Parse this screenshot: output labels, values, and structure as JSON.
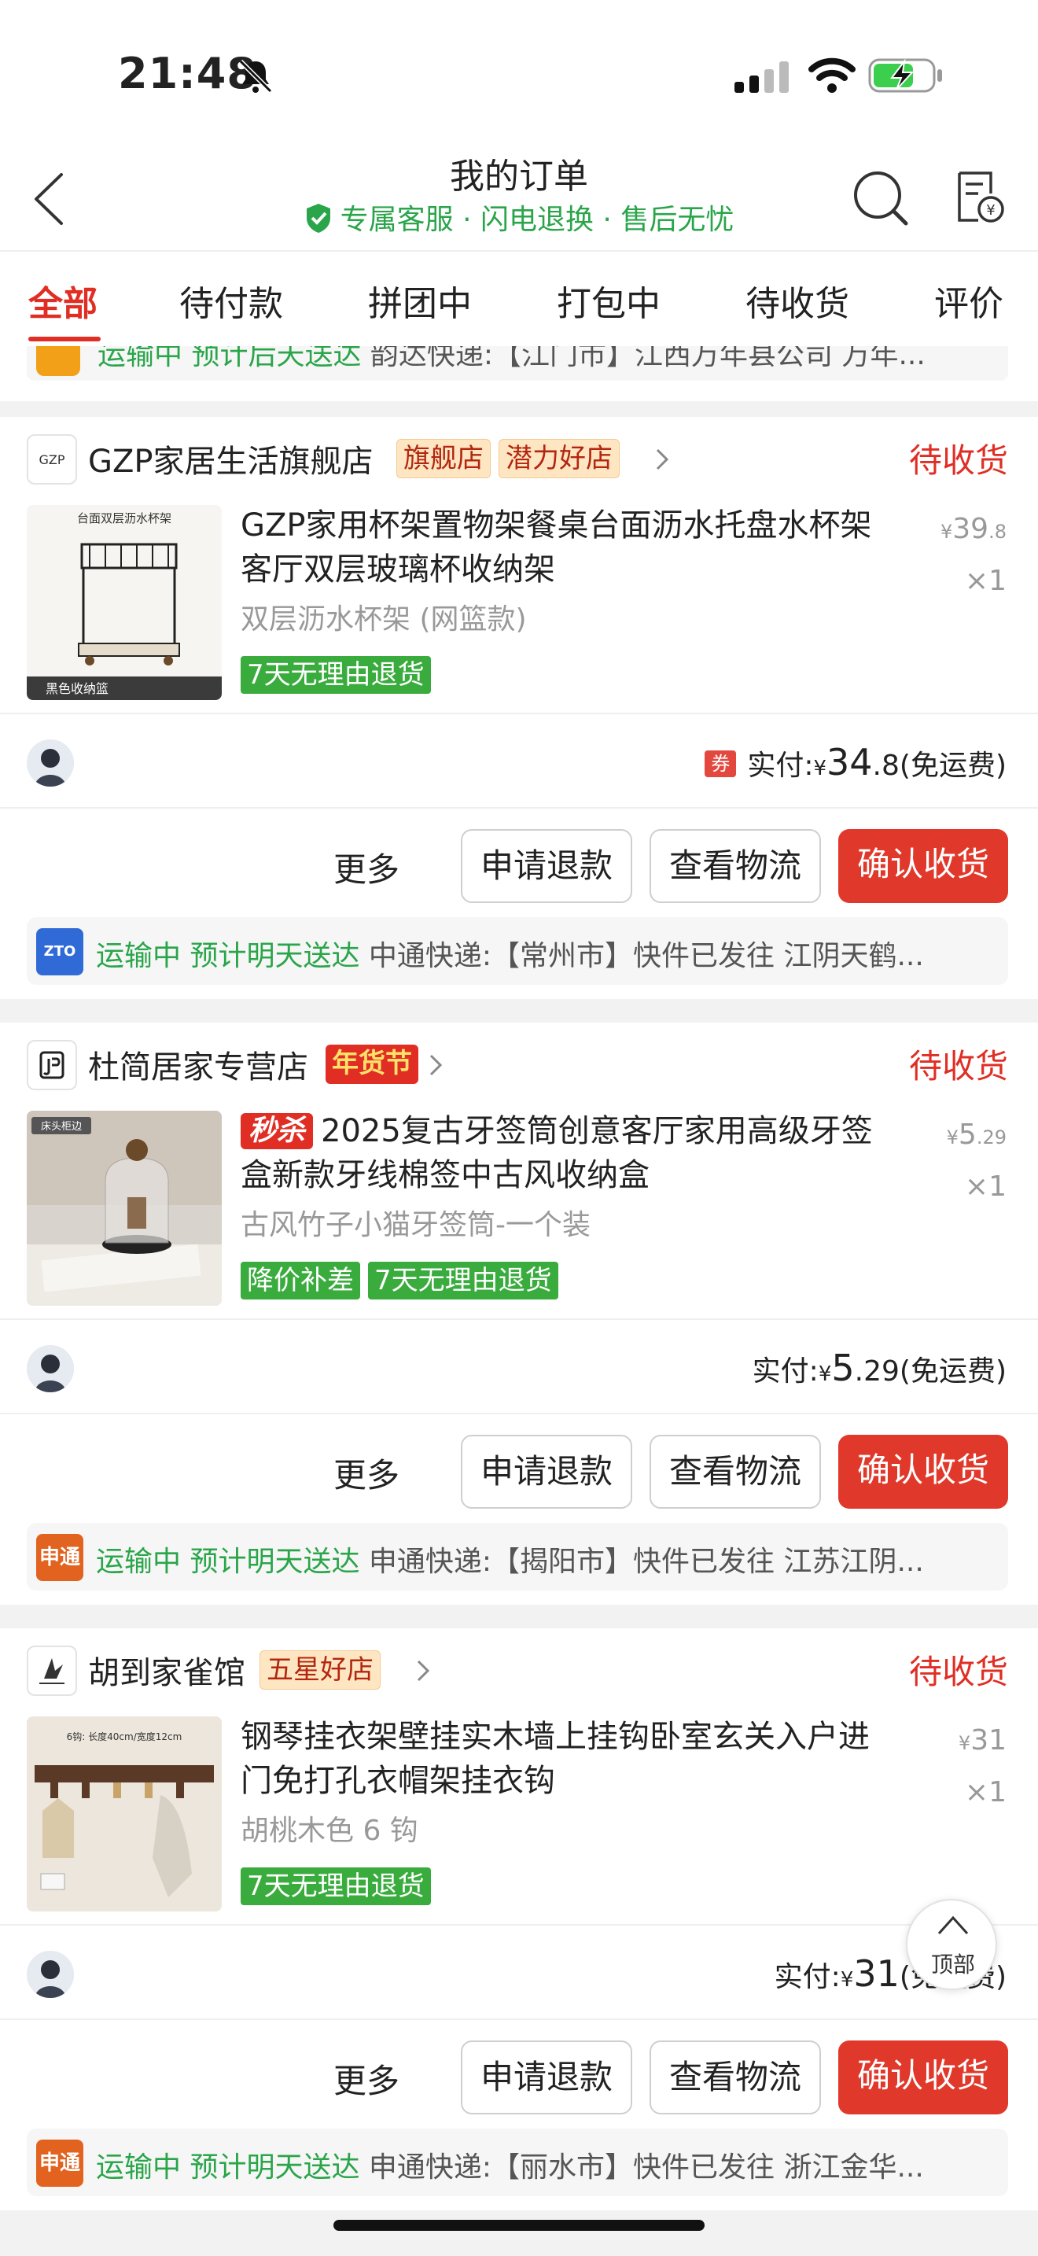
{
  "status_bar": {
    "time": "21:48"
  },
  "header": {
    "title": "我的订单",
    "subtitle": "专属客服 · 闪电退换 · 售后无忧"
  },
  "tabs": [
    "全部",
    "待付款",
    "拼团中",
    "打包中",
    "待收货",
    "评价"
  ],
  "partial_logistics": {
    "status": "运输中 预计后天送达",
    "detail": " 韵达快递:【江门市】江西万年县公司 万年..."
  },
  "common": {
    "more": "更多",
    "refund": "申请退款",
    "track": "查看物流",
    "confirm": "确认收货",
    "paid_label": "实付:",
    "yuan": "¥",
    "free_shipping": "(免运费)",
    "coupon": "券",
    "top_label": "顶部"
  },
  "orders": [
    {
      "shop": "GZP家居生活旗舰店",
      "shop_logo_text": "GZP",
      "badges": [
        "旗舰店",
        "潜力好店"
      ],
      "status": "待收货",
      "product": "GZP家用杯架置物架餐桌台面沥水托盘水杯架客厅双层玻璃杯收纳架",
      "image_text": "台面双层沥水杯架",
      "image_footer": "黑色收纳篮",
      "sku": "双层沥水杯架 (网篮款)",
      "tags": [
        "7天无理由退货"
      ],
      "price_int": "39",
      "price_dec": ".8",
      "qty": "×1",
      "paid_int": "34",
      "paid_dec": ".8",
      "logistics_logo": "ZTO",
      "logistics_status": "运输中 预计明天送达",
      "logistics_detail": " 中通快递:【常州市】快件已发往 江阴天鹤..."
    },
    {
      "shop": "杜简居家专营店",
      "badges": [
        "年货节"
      ],
      "status": "待收货",
      "seckill": "秒杀",
      "product": "2025复古牙签筒创意客厅家用高级牙签盒新款牙线棉签中古风收纳盒",
      "image_text": "床头柜边",
      "sku": "古风竹子小猫牙签筒-一个装",
      "tags": [
        "降价补差",
        "7天无理由退货"
      ],
      "price_int": "5",
      "price_dec": ".29",
      "qty": "×1",
      "paid_int": "5",
      "paid_dec": ".29",
      "logistics_logo": "申通",
      "logistics_status": "运输中 预计明天送达",
      "logistics_detail": " 申通快递:【揭阳市】快件已发往 江苏江阴..."
    },
    {
      "shop": "胡到家雀馆",
      "badges": [
        "五星好店"
      ],
      "status": "待收货",
      "product": "钢琴挂衣架壁挂实木墙上挂钩卧室玄关入户进门免打孔衣帽架挂衣钩",
      "image_text": "6钩: 长度40cm/宽度12cm",
      "sku": "胡桃木色 6 钩",
      "tags": [
        "7天无理由退货"
      ],
      "price_int": "31",
      "price_dec": "",
      "qty": "×1",
      "paid_int": "31",
      "paid_dec": "",
      "logistics_logo": "申通",
      "logistics_status": "运输中 预计明天送达",
      "logistics_detail": " 申通快递:【丽水市】快件已发往 浙江金华..."
    }
  ]
}
